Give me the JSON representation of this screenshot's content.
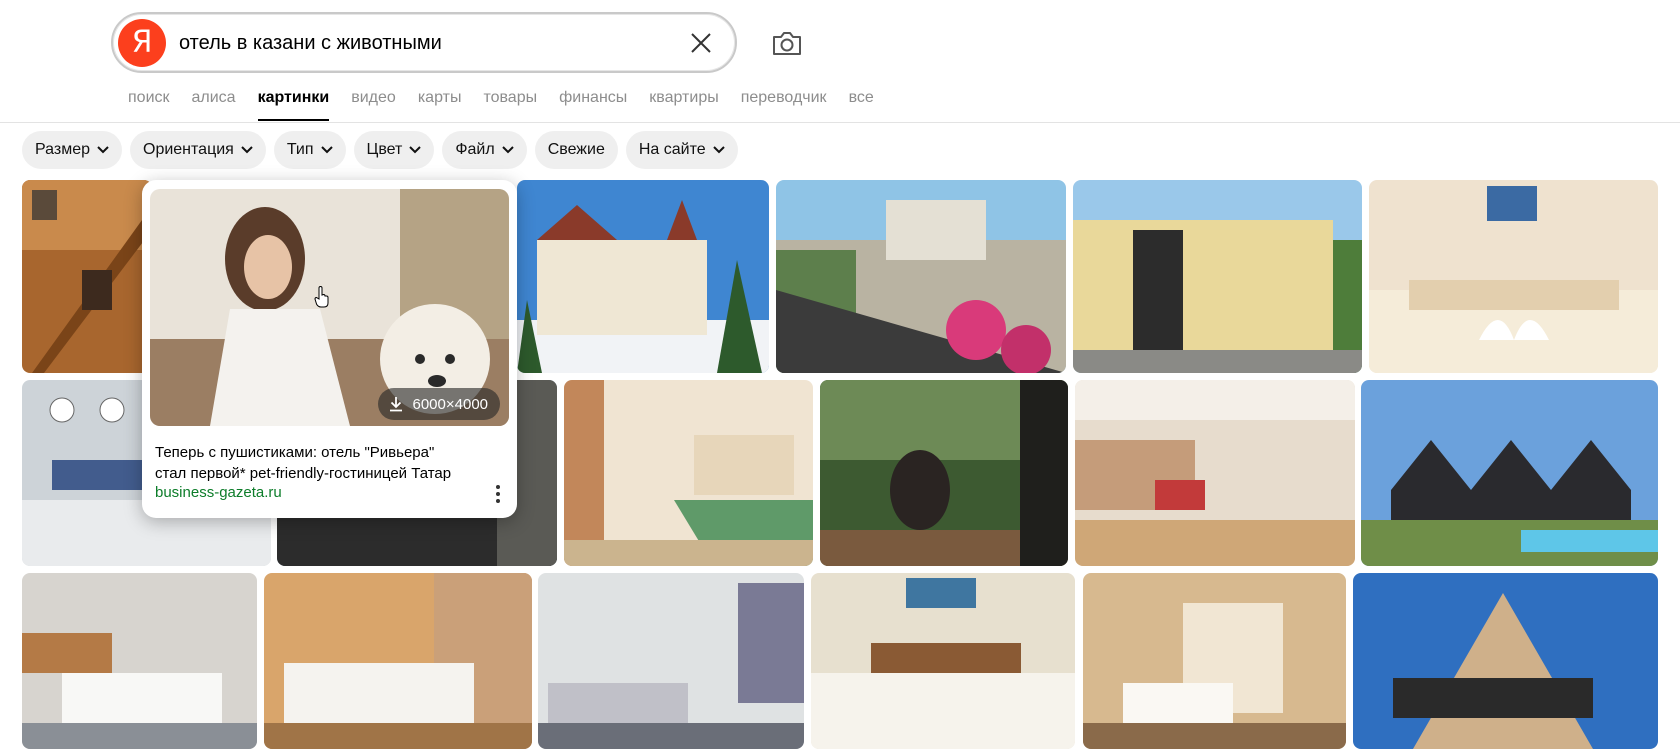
{
  "brand": {
    "logo_letter": "Я",
    "logo_color": "#fc3f1d"
  },
  "search": {
    "query": "отель в казани с животными"
  },
  "icons": {
    "clear": "close-icon",
    "camera": "camera-icon",
    "dropdown": "chevron-down-icon",
    "download": "download-icon",
    "more": "more-vertical-icon"
  },
  "tabs": [
    {
      "label": "поиск",
      "active": false
    },
    {
      "label": "алиса",
      "active": false
    },
    {
      "label": "картинки",
      "active": true
    },
    {
      "label": "видео",
      "active": false
    },
    {
      "label": "карты",
      "active": false
    },
    {
      "label": "товары",
      "active": false
    },
    {
      "label": "финансы",
      "active": false
    },
    {
      "label": "квартиры",
      "active": false
    },
    {
      "label": "переводчик",
      "active": false
    },
    {
      "label": "все",
      "active": false
    }
  ],
  "filters": [
    {
      "label": "Размер",
      "dropdown": true
    },
    {
      "label": "Ориентация",
      "dropdown": true
    },
    {
      "label": "Тип",
      "dropdown": true
    },
    {
      "label": "Цвет",
      "dropdown": true
    },
    {
      "label": "Файл",
      "dropdown": true
    },
    {
      "label": "Свежие",
      "dropdown": false
    },
    {
      "label": "На сайте",
      "dropdown": true
    }
  ],
  "results": [
    {
      "subject": "wooden staircase with dog"
    },
    {
      "subject": "hotel in snow"
    },
    {
      "subject": "balcony with flowers and parking"
    },
    {
      "subject": "yellow hostel building"
    },
    {
      "subject": "bed with towel swans"
    },
    {
      "subject": "AMAKS reception desk"
    },
    {
      "subject": "balcony view"
    },
    {
      "subject": "room with green bedspread"
    },
    {
      "subject": "forest balcony with hanging chair"
    },
    {
      "subject": "restaurant hall"
    },
    {
      "subject": "modern houses with pool"
    },
    {
      "subject": "room with kitchenette"
    },
    {
      "subject": "wooden room white bed"
    },
    {
      "subject": "twin room"
    },
    {
      "subject": "bed with towel swans and picture"
    },
    {
      "subject": "warm lit room"
    },
    {
      "subject": "AMAKS Safar Hotel tower"
    }
  ],
  "hover_card": {
    "subject": "woman with golden retriever",
    "size": "6000×4000",
    "title_line1": "Теперь с пушистиками: отель \"Ривьера\"",
    "title_line2": "стал первой* pet-friendly-гостиницей Татар",
    "source": "business-gazeta.ru"
  }
}
